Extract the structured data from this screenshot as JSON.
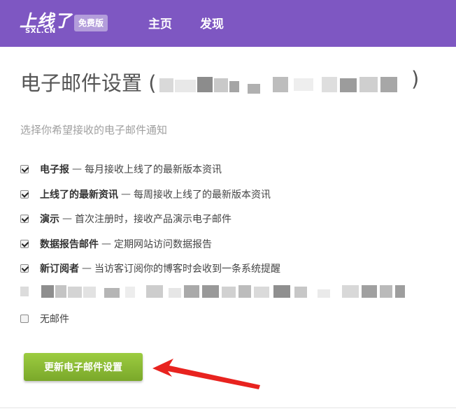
{
  "header": {
    "logo_text": "上线了",
    "logo_sub": "SXL.CN",
    "badge": "免费版",
    "nav": [
      {
        "label": "主页"
      },
      {
        "label": "发现"
      }
    ]
  },
  "main": {
    "title_prefix": "电子邮件设置 (",
    "title_suffix": ")",
    "subtitle": "选择你希望接收的电子邮件通知",
    "options": [
      {
        "name": "电子报",
        "sep": "—",
        "desc": "每月接收上线了的最新版本资讯",
        "checked": true
      },
      {
        "name": "上线了的最新资讯",
        "sep": "—",
        "desc": "每周接收上线了的最新版本资讯",
        "checked": true
      },
      {
        "name": "演示",
        "sep": "—",
        "desc": "首次注册时，接收产品演示电子邮件",
        "checked": true
      },
      {
        "name": "数据报告邮件",
        "sep": "—",
        "desc": "定期网站访问数据报告",
        "checked": true
      },
      {
        "name": "新订阅者",
        "sep": "—",
        "desc": "当访客订阅你的博客时会收到一条系统提醒",
        "checked": true
      }
    ],
    "no_mail": {
      "label": "无邮件",
      "checked": false
    },
    "submit_label": "更新电子邮件设置"
  },
  "colors": {
    "header_bg": "#7e57c2",
    "badge_bg": "#b39ddb",
    "button_bg": "#8bc34a",
    "arrow": "#e8231f"
  }
}
